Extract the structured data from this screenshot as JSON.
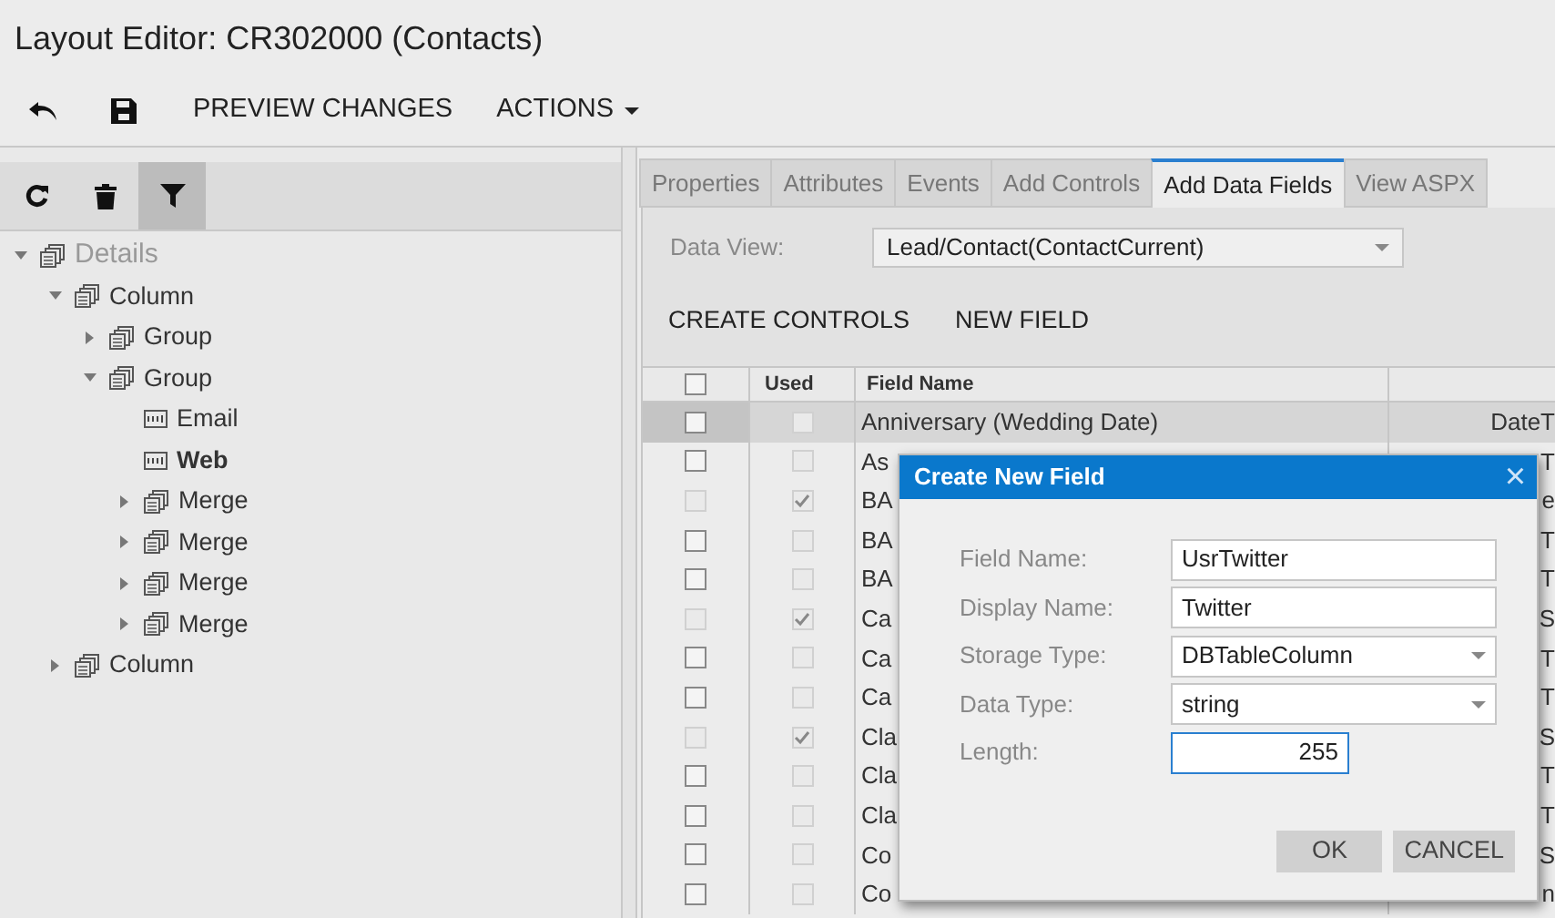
{
  "window": {
    "title": "Layout Editor: CR302000 (Contacts)"
  },
  "toolbar": {
    "buttons": [
      {
        "kind": "undo"
      },
      {
        "kind": "save"
      },
      {
        "kind": "text",
        "label": "PREVIEW CHANGES"
      },
      {
        "kind": "menu",
        "label": "ACTIONS"
      }
    ]
  },
  "tree_toolbar": [
    {
      "kind": "refresh",
      "pressed": false
    },
    {
      "kind": "delete",
      "pressed": false
    },
    {
      "kind": "filter",
      "pressed": true
    }
  ],
  "tree": [
    {
      "label": "Details",
      "kind": "group",
      "expanded": true,
      "dimmed": true,
      "bold": false,
      "children": [
        {
          "label": "Column",
          "kind": "group",
          "expanded": true,
          "dimmed": false,
          "bold": false,
          "children": [
            {
              "label": "Group",
              "kind": "group",
              "expanded": false,
              "dimmed": false,
              "bold": false
            },
            {
              "label": "Group",
              "kind": "group",
              "expanded": true,
              "dimmed": false,
              "bold": false,
              "children": [
                {
                  "label": "Email",
                  "kind": "field",
                  "dimmed": false,
                  "bold": false
                },
                {
                  "label": "Web",
                  "kind": "field",
                  "dimmed": false,
                  "bold": true
                },
                {
                  "label": "Merge",
                  "kind": "group",
                  "expanded": false,
                  "dimmed": false,
                  "bold": false
                },
                {
                  "label": "Merge",
                  "kind": "group",
                  "expanded": false,
                  "dimmed": false,
                  "bold": false
                },
                {
                  "label": "Merge",
                  "kind": "group",
                  "expanded": false,
                  "dimmed": false,
                  "bold": false
                },
                {
                  "label": "Merge",
                  "kind": "group",
                  "expanded": false,
                  "dimmed": false,
                  "bold": false
                }
              ]
            }
          ]
        },
        {
          "label": "Column",
          "kind": "group",
          "expanded": false,
          "dimmed": false,
          "bold": false
        }
      ]
    }
  ],
  "tabs": [
    {
      "label": "Properties",
      "selected": false
    },
    {
      "label": "Attributes",
      "selected": false
    },
    {
      "label": "Events",
      "selected": false
    },
    {
      "label": "Add Controls",
      "selected": false
    },
    {
      "label": "Add Data Fields",
      "selected": true
    },
    {
      "label": "View ASPX",
      "selected": false
    }
  ],
  "data_view": {
    "label": "Data View:",
    "value": "Lead/Contact(ContactCurrent)"
  },
  "actions": [
    "CREATE CONTROLS",
    "NEW FIELD"
  ],
  "table": {
    "select_all_checked": false,
    "columns": [
      "Used",
      "Field Name"
    ],
    "rows": [
      {
        "checked": false,
        "used": false,
        "selected": true,
        "field_name": "Anniversary (Wedding Date)",
        "column_4": "DateT"
      },
      {
        "checked": false,
        "used": false,
        "selected": false,
        "field_name": "As",
        "column_4": "T"
      },
      {
        "checked": false,
        "used": true,
        "selected": false,
        "field_name": "BA",
        "column_4": "e"
      },
      {
        "checked": false,
        "used": false,
        "selected": false,
        "field_name": "BA",
        "column_4": "T"
      },
      {
        "checked": false,
        "used": false,
        "selected": false,
        "field_name": "BA",
        "column_4": "T"
      },
      {
        "checked": false,
        "used": true,
        "selected": false,
        "field_name": "Ca",
        "column_4": "S"
      },
      {
        "checked": false,
        "used": false,
        "selected": false,
        "field_name": "Ca",
        "column_4": "T"
      },
      {
        "checked": false,
        "used": false,
        "selected": false,
        "field_name": "Ca",
        "column_4": "T"
      },
      {
        "checked": false,
        "used": true,
        "selected": false,
        "field_name": "Cla",
        "column_4": "S"
      },
      {
        "checked": false,
        "used": false,
        "selected": false,
        "field_name": "Cla",
        "column_4": "T"
      },
      {
        "checked": false,
        "used": false,
        "selected": false,
        "field_name": "Cla",
        "column_4": "T"
      },
      {
        "checked": false,
        "used": false,
        "selected": false,
        "field_name": "Co",
        "column_4": "S"
      },
      {
        "checked": false,
        "used": false,
        "selected": false,
        "field_name": "Co",
        "column_4": "n"
      }
    ]
  },
  "dialog": {
    "title": "Create New Field",
    "close": "×",
    "fields": [
      {
        "label": "Field Name:",
        "value": "UsrTwitter",
        "kind": "text",
        "focused": false
      },
      {
        "label": "Display Name:",
        "value": "Twitter",
        "kind": "text",
        "focused": false
      },
      {
        "label": "Storage Type:",
        "value": "DBTableColumn",
        "kind": "select",
        "focused": false
      },
      {
        "label": "Data Type:",
        "value": "string",
        "kind": "select",
        "focused": false
      },
      {
        "label": "Length:",
        "value": "255",
        "kind": "number",
        "focused": true
      }
    ],
    "buttons": [
      "OK",
      "CANCEL"
    ]
  }
}
